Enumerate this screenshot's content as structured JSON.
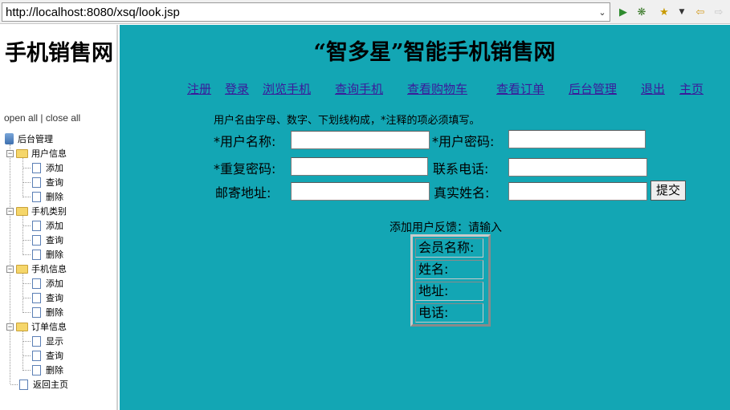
{
  "browser": {
    "url": "http://localhost:8080/xsq/look.jsp",
    "toolbar_icons": [
      "play-icon",
      "debug-icon",
      "tool-icon",
      "dropdown-icon",
      "back-icon",
      "forward-icon"
    ]
  },
  "sidebar": {
    "title": "手机销售网",
    "open_all": "open all",
    "separator": "|",
    "close_all": "close all",
    "root": "后台管理",
    "groups": [
      {
        "label": "用户信息",
        "items": [
          "添加",
          "查询",
          "删除"
        ]
      },
      {
        "label": "手机类别",
        "items": [
          "添加",
          "查询",
          "删除"
        ]
      },
      {
        "label": "手机信息",
        "items": [
          "添加",
          "查询",
          "删除"
        ]
      },
      {
        "label": "订单信息",
        "items": [
          "显示",
          "查询",
          "删除"
        ]
      }
    ],
    "home": "返回主页"
  },
  "main": {
    "title": "“智多星”智能手机销售网",
    "nav": [
      "注册",
      "登录",
      "浏览手机",
      "查询手机",
      "查看购物车",
      "查看订单",
      "后台管理",
      "退出",
      "主页"
    ],
    "hint": "用户名由字母、数字、下划线构成，*注释的项必须填写。",
    "form": {
      "username_label": "*用户名称:",
      "password_label": "*用户密码:",
      "repeat_label": "*重复密码:",
      "phone_label": "联系电话:",
      "address_label": "邮寄地址:",
      "realname_label": "真实姓名:",
      "submit": "提交"
    },
    "feedback": {
      "title": "添加用户反馈：请输入",
      "rows": [
        "会员名称:",
        "姓名:",
        "地址:",
        "电话:"
      ]
    },
    "colors": {
      "background": "#13a6b4",
      "link": "#3b1a9a"
    }
  }
}
